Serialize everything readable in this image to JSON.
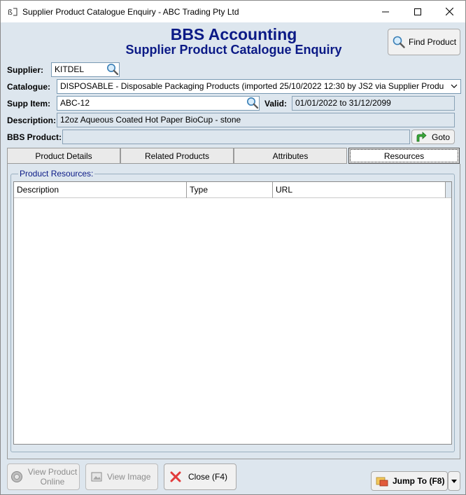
{
  "window": {
    "title": "Supplier Product Catalogue Enquiry - ABC Trading Pty Ltd"
  },
  "heading": {
    "app_name": "BBS Accounting",
    "screen_name": "Supplier Product Catalogue Enquiry"
  },
  "toolbar": {
    "find_product_label": "Find Product"
  },
  "form": {
    "supplier_label": "Supplier:",
    "supplier_value": "KITDEL",
    "catalogue_label": "Catalogue:",
    "catalogue_value": "DISPOSABLE - Disposable Packaging Products (imported 25/10/2022 12:30 by JS2 via Supplier Produ",
    "supp_item_label": "Supp Item:",
    "supp_item_value": "ABC-12",
    "valid_label": "Valid:",
    "valid_value": "01/01/2022 to 31/12/2099",
    "description_label": "Description:",
    "description_value": "12oz Aqueous Coated Hot Paper BioCup - stone",
    "bbs_product_label": "BBS Product:",
    "bbs_product_value": "",
    "goto_label": "Goto"
  },
  "tabs": [
    {
      "label": "Product Details",
      "active": false
    },
    {
      "label": "Related Products",
      "active": false
    },
    {
      "label": "Attributes",
      "active": false
    },
    {
      "label": "Resources",
      "active": true
    }
  ],
  "resources": {
    "group_label": "Product Resources:",
    "columns": [
      "Description",
      "Type",
      "URL"
    ],
    "rows": []
  },
  "bottom": {
    "view_online_line1": "View Product",
    "view_online_line2": "Online",
    "view_image_label": "View Image",
    "close_label": "Close (F4)",
    "jump_to_label": "Jump To (F8)"
  },
  "colors": {
    "heading": "#0b1a86",
    "window_bg": "#dde6ee",
    "close_icon": "#e23b3b",
    "goto_icon": "#2f9a2f"
  },
  "icons": {
    "lookup": "magnifier-icon",
    "goto": "green-arrow-icon",
    "close": "red-x-icon",
    "jump": "jump-folder-icon"
  }
}
